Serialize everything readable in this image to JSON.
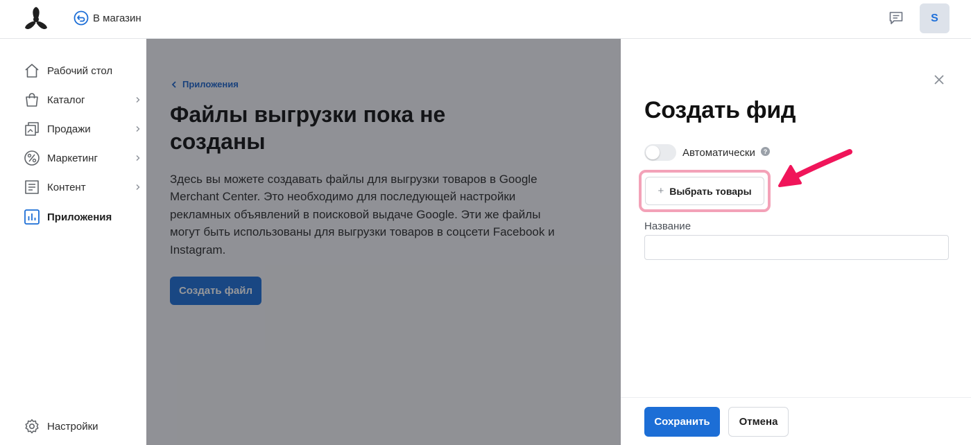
{
  "header": {
    "back_to_store": "В магазин",
    "avatar_letter": "S",
    "icons": [
      "logo-icon",
      "back-arrow-icon",
      "chat-icon"
    ]
  },
  "sidebar": {
    "items": [
      {
        "label": "Рабочий стол",
        "icon": "home-icon",
        "has_chevron": false
      },
      {
        "label": "Каталог",
        "icon": "bag-icon",
        "has_chevron": true
      },
      {
        "label": "Продажи",
        "icon": "sales-icon",
        "has_chevron": true
      },
      {
        "label": "Маркетинг",
        "icon": "percent-icon",
        "has_chevron": true
      },
      {
        "label": "Контент",
        "icon": "content-icon",
        "has_chevron": true
      },
      {
        "label": "Приложения",
        "icon": "apps-icon",
        "has_chevron": false,
        "active": true
      }
    ],
    "settings": {
      "label": "Настройки",
      "icon": "gear-icon"
    }
  },
  "main": {
    "breadcrumb": "Приложения",
    "title": "Файлы выгрузки пока не созданы",
    "description": "Здесь вы можете создавать файлы для выгрузки товаров в Google Merchant Center. Это необходимо для последующей настройки рекламных объявлений в поисковой выдаче Google. Эти же файлы могут быть использованы для выгрузки товаров в соцсети Facebook и Instagram.",
    "create_button": "Создать файл"
  },
  "drawer": {
    "title": "Создать фид",
    "toggle_label": "Автоматически",
    "toggle_on": false,
    "select_products_plus": "+",
    "select_products": "Выбрать товары",
    "name_label": "Название",
    "name_value": "",
    "save_button": "Сохранить",
    "cancel_button": "Отмена"
  },
  "colors": {
    "accent": "#1c6ed6",
    "highlight_border": "#f3a2b8",
    "arrow": "#f0155a",
    "overlay": "rgba(22,24,30,0.45)"
  }
}
